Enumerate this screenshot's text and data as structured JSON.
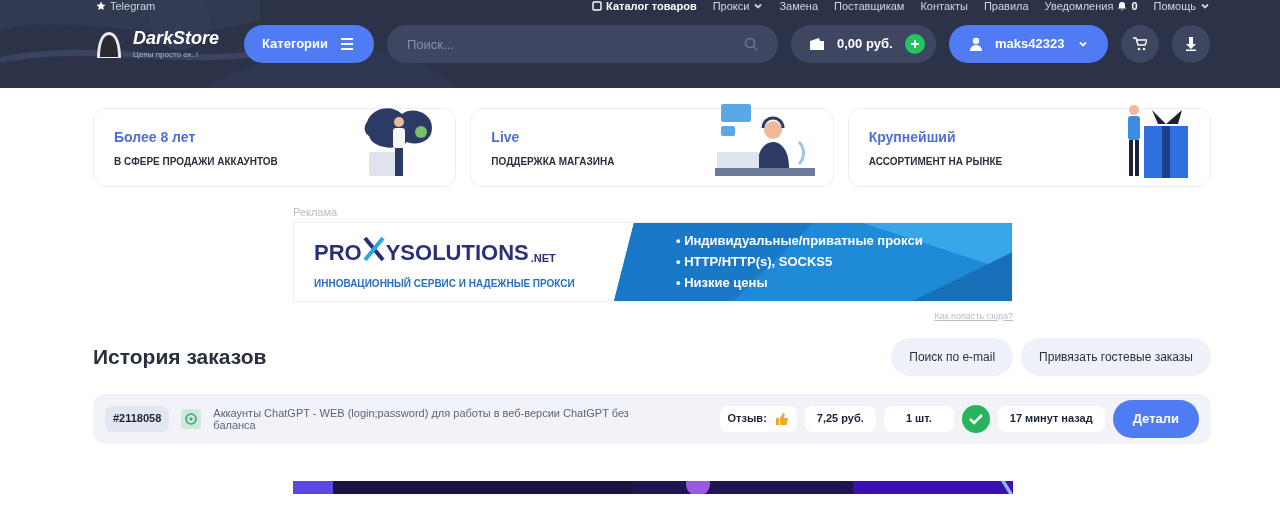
{
  "top_nav": {
    "telegram": "Telegram",
    "links": [
      {
        "label": "Каталог товаров",
        "kind": "catalog"
      },
      {
        "label": "Прокси",
        "kind": "dropdown"
      },
      {
        "label": "Замена",
        "kind": "plain"
      },
      {
        "label": "Поставщикам",
        "kind": "plain"
      },
      {
        "label": "Контакты",
        "kind": "plain"
      },
      {
        "label": "Правила",
        "kind": "plain"
      },
      {
        "label": "Уведомления",
        "kind": "notifications",
        "count": "0"
      },
      {
        "label": "Помощь",
        "kind": "dropdown"
      }
    ]
  },
  "header": {
    "logo": {
      "name": "DarkStore",
      "tagline": "Цены просто ох..!"
    },
    "categories_button": "Категории",
    "search": {
      "placeholder": "Поиск..."
    },
    "balance": "0,00 руб.",
    "user": "maks42323"
  },
  "features": [
    {
      "title": "Более 8 лет",
      "subtitle": "В СФЕРЕ ПРОДАЖИ АККАУНТОВ",
      "kind": "people"
    },
    {
      "title": "Live",
      "subtitle": "ПОДДЕРЖКА МАГАЗИНА",
      "kind": "support"
    },
    {
      "title": "Крупнейший",
      "subtitle": "АССОРТИМЕНТ НА РЫНКЕ",
      "kind": "gift"
    }
  ],
  "ad": {
    "label": "Реклама",
    "brand_left": "PRO",
    "brand_right": "YSOLUTIONS",
    "brand_tld": ".NET",
    "slogan": "ИННОВАЦИОННЫЙ СЕРВИС И НАДЕЖНЫЕ ПРОКСИ",
    "bullets": [
      "• Индивидуальные/приватные прокси",
      "• HTTP/HTTP(s), SOCKS5",
      "• Низкие цены"
    ],
    "link": "Как попасть сюда?"
  },
  "orders": {
    "title": "История заказов",
    "buttons": [
      "Поиск по e-mail",
      "Привязать гостевые заказы"
    ],
    "rows": [
      {
        "id": "#2118058",
        "product": "Аккаунты ChatGPT - WEB (login;password) для работы в веб-версии ChatGPT без баланса",
        "review_label": "Отзыв:",
        "price": "7,25 руб.",
        "qty": "1 шт.",
        "completed": true,
        "time": "17 минут назад",
        "details": "Детали"
      }
    ]
  }
}
